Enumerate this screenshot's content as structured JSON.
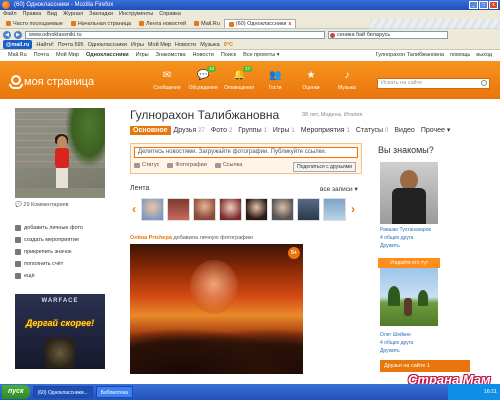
{
  "window": {
    "title": "(60) Одноклассники - Mozilla Firefox",
    "min": "_",
    "max": "□",
    "close": "x"
  },
  "menu": [
    "Файл",
    "Правка",
    "Вид",
    "Журнал",
    "Закладки",
    "Инструменты",
    "Справка"
  ],
  "bookmarks": [
    {
      "label": "Часто посещаемые",
      "active": false
    },
    {
      "label": "Начальная страница",
      "active": false
    },
    {
      "label": "Лента новостей",
      "active": false
    },
    {
      "label": "Mail.Ru",
      "active": false
    },
    {
      "label": "(60) Одноклассники",
      "active": true
    },
    {
      "label": "x",
      "active": false
    }
  ],
  "address": {
    "url": "www.odnoklassniki.ru",
    "search": "сеника бай беларусь"
  },
  "mailbar": {
    "logo": "@mail.ru",
    "items": [
      "Найти!",
      "Почта 595",
      "Одноклассники",
      "Игры",
      "Мой Мир",
      "Новости",
      "Музыка",
      "0°C"
    ]
  },
  "sitenav": {
    "items": [
      "Mail.Ru",
      "Почта",
      "Мой Мир",
      "Одноклассники",
      "Игры",
      "Знакомства",
      "Новости",
      "Поиск",
      "Все проекты ▾"
    ],
    "bold_item": "Одноклассники",
    "right": [
      "Гулнорахон Талибжановна",
      "помощь",
      "выход"
    ]
  },
  "header": {
    "title": "моя страница",
    "nav": [
      {
        "icon": "✉",
        "label": "Сообщения",
        "count": ""
      },
      {
        "icon": "💬",
        "label": "Обсуждения",
        "count": "10"
      },
      {
        "icon": "🔔",
        "label": "Оповещения",
        "count": "17"
      },
      {
        "icon": "👥",
        "label": "Гости",
        "count": ""
      },
      {
        "icon": "★",
        "label": "Оценки",
        "count": ""
      },
      {
        "icon": "♪",
        "label": "Музыка",
        "count": ""
      }
    ],
    "search_placeholder": "Искать на сайте"
  },
  "profile": {
    "name": "Гулнорахон Талибжановна",
    "meta": "38 лет, Модена, Италия",
    "tabs": [
      {
        "label": "Основное",
        "count": "",
        "active": true
      },
      {
        "label": "Друзья",
        "count": "27",
        "active": false
      },
      {
        "label": "Фото",
        "count": "2",
        "active": false
      },
      {
        "label": "Группы",
        "count": "1",
        "active": false
      },
      {
        "label": "Игры",
        "count": "1",
        "active": false
      },
      {
        "label": "Мероприятия",
        "count": "1",
        "active": false
      },
      {
        "label": "Статусы",
        "count": "0",
        "active": false
      },
      {
        "label": "Видео",
        "count": "",
        "active": false
      },
      {
        "label": "Прочее ▾",
        "count": "",
        "active": false
      }
    ]
  },
  "left": {
    "comments": "29 Комментариев",
    "menu": [
      "добавить личные фото",
      "создать мероприятие",
      "прикрепить значок",
      "пополнить счёт",
      "ещё"
    ],
    "ad": {
      "logo": "WARFACE",
      "text": "Дергай скорее!"
    }
  },
  "status": {
    "placeholder": "Делитесь новостями. Загружайте фотографии. Публикуйте ссылки.",
    "actions": [
      "Статус",
      "Фотографии",
      "Ссылка"
    ],
    "share": "Поделиться с друзьями"
  },
  "feed": {
    "title": "Лента",
    "all": "все записи ▾",
    "post_author": "Олёна Prishepa",
    "post_text": "добавила личную фотографию",
    "sticker": "5+"
  },
  "right": {
    "title": "Вы знакомы?",
    "person1": {
      "name": "Равшан Тухтаназаров",
      "sub": "4 общих друга",
      "add": "Дружить"
    },
    "promo": "Угадайте кто тут",
    "person2": {
      "name": "Олег Шейкин",
      "sub": "4 общих друга",
      "add": "Дружить"
    },
    "friends_online": "Друзья на сайте 1"
  },
  "watermark": "Страна Мам",
  "taskbar": {
    "start": "пуск",
    "tasks": [
      "(60) Одноклассники...",
      "Библиотека"
    ],
    "active_task": 0,
    "clock": "16:11"
  }
}
